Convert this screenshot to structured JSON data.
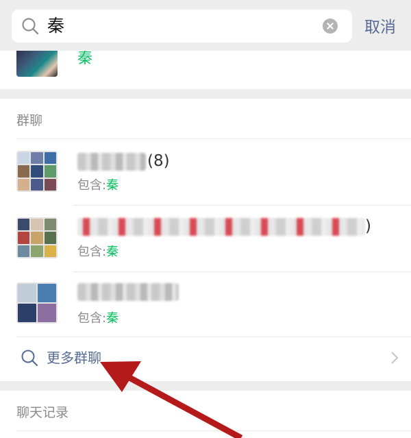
{
  "search": {
    "query": "秦",
    "cancel_label": "取消"
  },
  "contacts": {
    "name": "秦"
  },
  "groups": {
    "title": "群聊",
    "items": [
      {
        "name_suffix": "(8)",
        "contains_label": "包含:",
        "match": "秦"
      },
      {
        "name_suffix": ")",
        "contains_label": "包含:",
        "match": "秦"
      },
      {
        "name_suffix": "",
        "contains_label": "包含:",
        "match": "秦"
      }
    ],
    "more_label": "更多群聊"
  },
  "chat_history": {
    "title": "聊天记录"
  },
  "colors": {
    "highlight": "#07c160",
    "link": "#576b95",
    "annotation_arrow": "#b51a1a"
  },
  "icons": [
    "search-icon",
    "clear-icon",
    "chevron-right-icon",
    "arrow-annotation"
  ]
}
